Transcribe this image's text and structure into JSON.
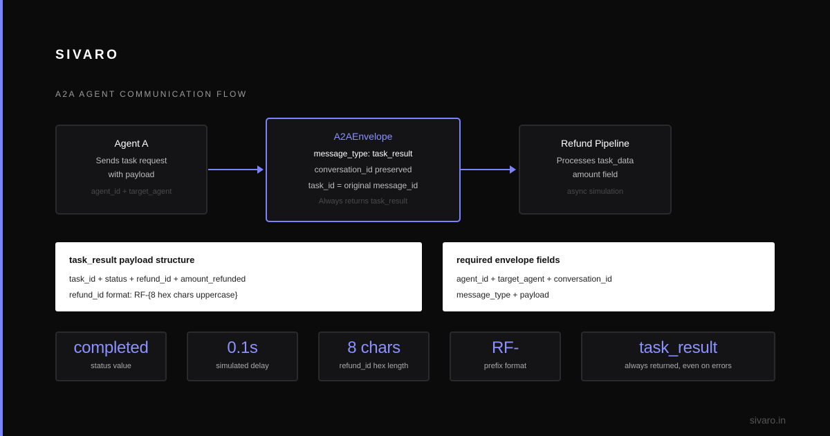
{
  "brand": "SIVARO",
  "subtitle": "A2A AGENT COMMUNICATION FLOW",
  "flow": {
    "agent_a": {
      "title": "Agent A",
      "lines": [
        "Sends task request",
        "with payload"
      ],
      "note": "agent_id + target_agent"
    },
    "envelope": {
      "title": "A2AEnvelope",
      "lines": [
        "message_type: task_result",
        "conversation_id preserved",
        "task_id = original message_id"
      ],
      "note": "Always returns task_result"
    },
    "pipeline": {
      "title": "Refund Pipeline",
      "lines": [
        "Processes task_data",
        "amount field"
      ],
      "note": "async simulation"
    }
  },
  "cards": [
    {
      "title": "task_result payload structure",
      "lines": [
        "task_id + status + refund_id + amount_refunded",
        "refund_id format: RF-{8 hex chars uppercase}"
      ]
    },
    {
      "title": "required envelope fields",
      "lines": [
        "agent_id + target_agent + conversation_id",
        "message_type + payload"
      ]
    }
  ],
  "stats": [
    {
      "value": "completed",
      "label": "status value"
    },
    {
      "value": "0.1s",
      "label": "simulated delay"
    },
    {
      "value": "8 chars",
      "label": "refund_id hex length"
    },
    {
      "value": "RF-",
      "label": "prefix format"
    },
    {
      "value": "task_result",
      "label": "always returned, even on errors"
    }
  ],
  "footer": "sivaro.in",
  "colors": {
    "accent": "#7c83ff",
    "background": "#0b0b0b",
    "panel": "#141416"
  }
}
